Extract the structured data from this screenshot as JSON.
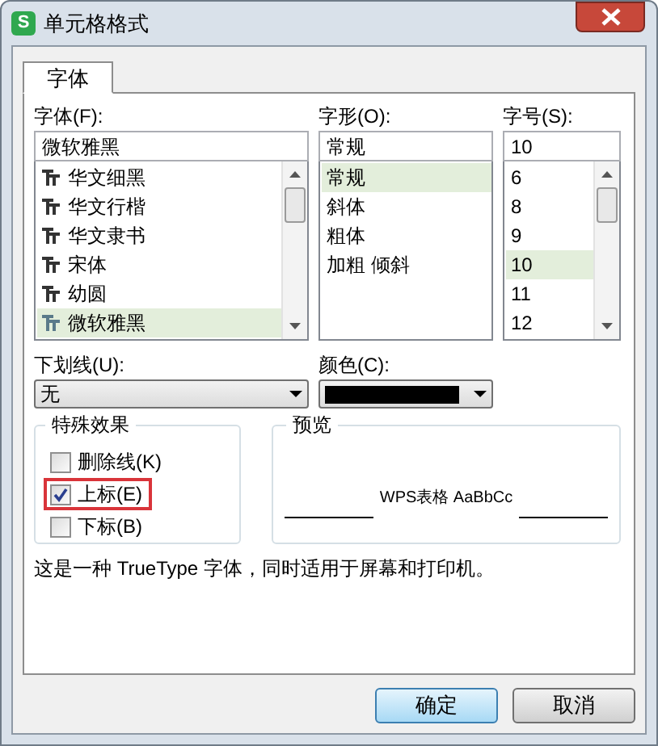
{
  "window": {
    "title": "单元格格式",
    "logo": "S"
  },
  "tabs": [
    {
      "label": "字体",
      "selected": true
    }
  ],
  "font": {
    "label": "字体(F):",
    "value": "微软雅黑",
    "items": [
      {
        "label": "华文细黑",
        "selected": false
      },
      {
        "label": "华文行楷",
        "selected": false
      },
      {
        "label": "华文隶书",
        "selected": false
      },
      {
        "label": "宋体",
        "selected": false
      },
      {
        "label": "幼圆",
        "selected": false
      },
      {
        "label": "微软雅黑",
        "selected": true
      }
    ]
  },
  "style": {
    "label": "字形(O):",
    "value": "常规",
    "items": [
      {
        "label": "常规",
        "selected": true
      },
      {
        "label": "斜体",
        "selected": false
      },
      {
        "label": "粗体",
        "selected": false
      },
      {
        "label": "加粗 倾斜",
        "selected": false
      }
    ]
  },
  "size": {
    "label": "字号(S):",
    "value": "10",
    "items": [
      {
        "label": "6",
        "selected": false
      },
      {
        "label": "8",
        "selected": false
      },
      {
        "label": "9",
        "selected": false
      },
      {
        "label": "10",
        "selected": true
      },
      {
        "label": "11",
        "selected": false
      },
      {
        "label": "12",
        "selected": false
      }
    ]
  },
  "underline": {
    "label": "下划线(U):",
    "value": "无"
  },
  "color": {
    "label": "颜色(C):",
    "color": "#000000"
  },
  "effects": {
    "title": "特殊效果",
    "items": [
      {
        "label": "删除线(K)",
        "checked": false,
        "highlighted": false
      },
      {
        "label": "上标(E)",
        "checked": true,
        "highlighted": true
      },
      {
        "label": "下标(B)",
        "checked": false,
        "highlighted": false
      }
    ]
  },
  "preview": {
    "title": "预览",
    "sample": "WPS表格 AaBbCc"
  },
  "description": "这是一种 TrueType 字体，同时适用于屏幕和打印机。",
  "buttons": [
    {
      "label": "确定",
      "kind": "default"
    },
    {
      "label": "取消",
      "kind": "normal"
    }
  ]
}
